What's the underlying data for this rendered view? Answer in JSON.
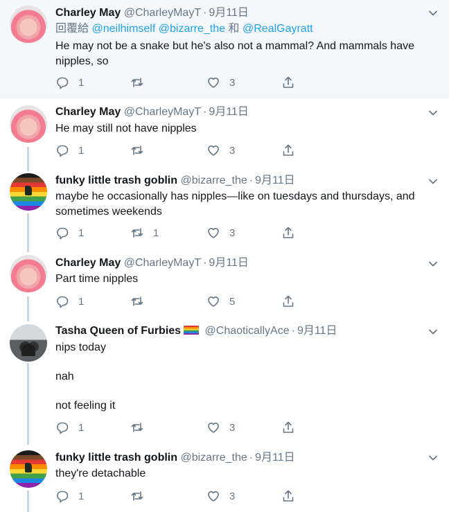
{
  "colors": {
    "text": "#14171a",
    "muted": "#657786",
    "link": "#1da1f2",
    "thread_line": "#ccd6dd",
    "highlight_bg": "#f5f8fa"
  },
  "tweets": [
    {
      "name": "Charley May",
      "handle": "@CharleyMayT",
      "date": "9月11日",
      "reply_prefix": "回覆給",
      "reply_mentions": [
        "@neilhimself",
        "@bizarre_the",
        "@RealGayratt"
      ],
      "reply_joiner": "和",
      "text": "He may not be a snake but he's also not a mammal? And mammals have\nnipples, so",
      "replies": "1",
      "retweets": "",
      "likes": "3",
      "avatar_icon": "pink-hair-portrait"
    },
    {
      "name": "Charley May",
      "handle": "@CharleyMayT",
      "date": "9月11日",
      "text": "He may still not have nipples",
      "replies": "1",
      "retweets": "",
      "likes": "3",
      "avatar_icon": "pink-hair-portrait"
    },
    {
      "name": "funky little trash goblin",
      "handle": "@bizarre_the",
      "date": "9月11日",
      "text": "maybe he occasionally has nipples—like on tuesdays and thursdays, and\nsometimes weekends",
      "replies": "1",
      "retweets": "1",
      "likes": "3",
      "avatar_icon": "pride-flag-goblin"
    },
    {
      "name": "Charley May",
      "handle": "@CharleyMayT",
      "date": "9月11日",
      "text": "Part time nipples",
      "replies": "1",
      "retweets": "",
      "likes": "5",
      "avatar_icon": "pink-hair-portrait"
    },
    {
      "name": "Tasha Queen of Furbies",
      "handle": "@ChaoticallyAce",
      "date": "9月11日",
      "name_badge": "rainbow-flag-emoji",
      "text": "nips today\n\nnah\n\nnot feeling it",
      "replies": "1",
      "retweets": "",
      "likes": "3",
      "avatar_icon": "group-photo"
    },
    {
      "name": "funky little trash goblin",
      "handle": "@bizarre_the",
      "date": "9月11日",
      "text": "they're detachable",
      "replies": "1",
      "retweets": "",
      "likes": "3",
      "avatar_icon": "pride-flag-goblin"
    }
  ]
}
